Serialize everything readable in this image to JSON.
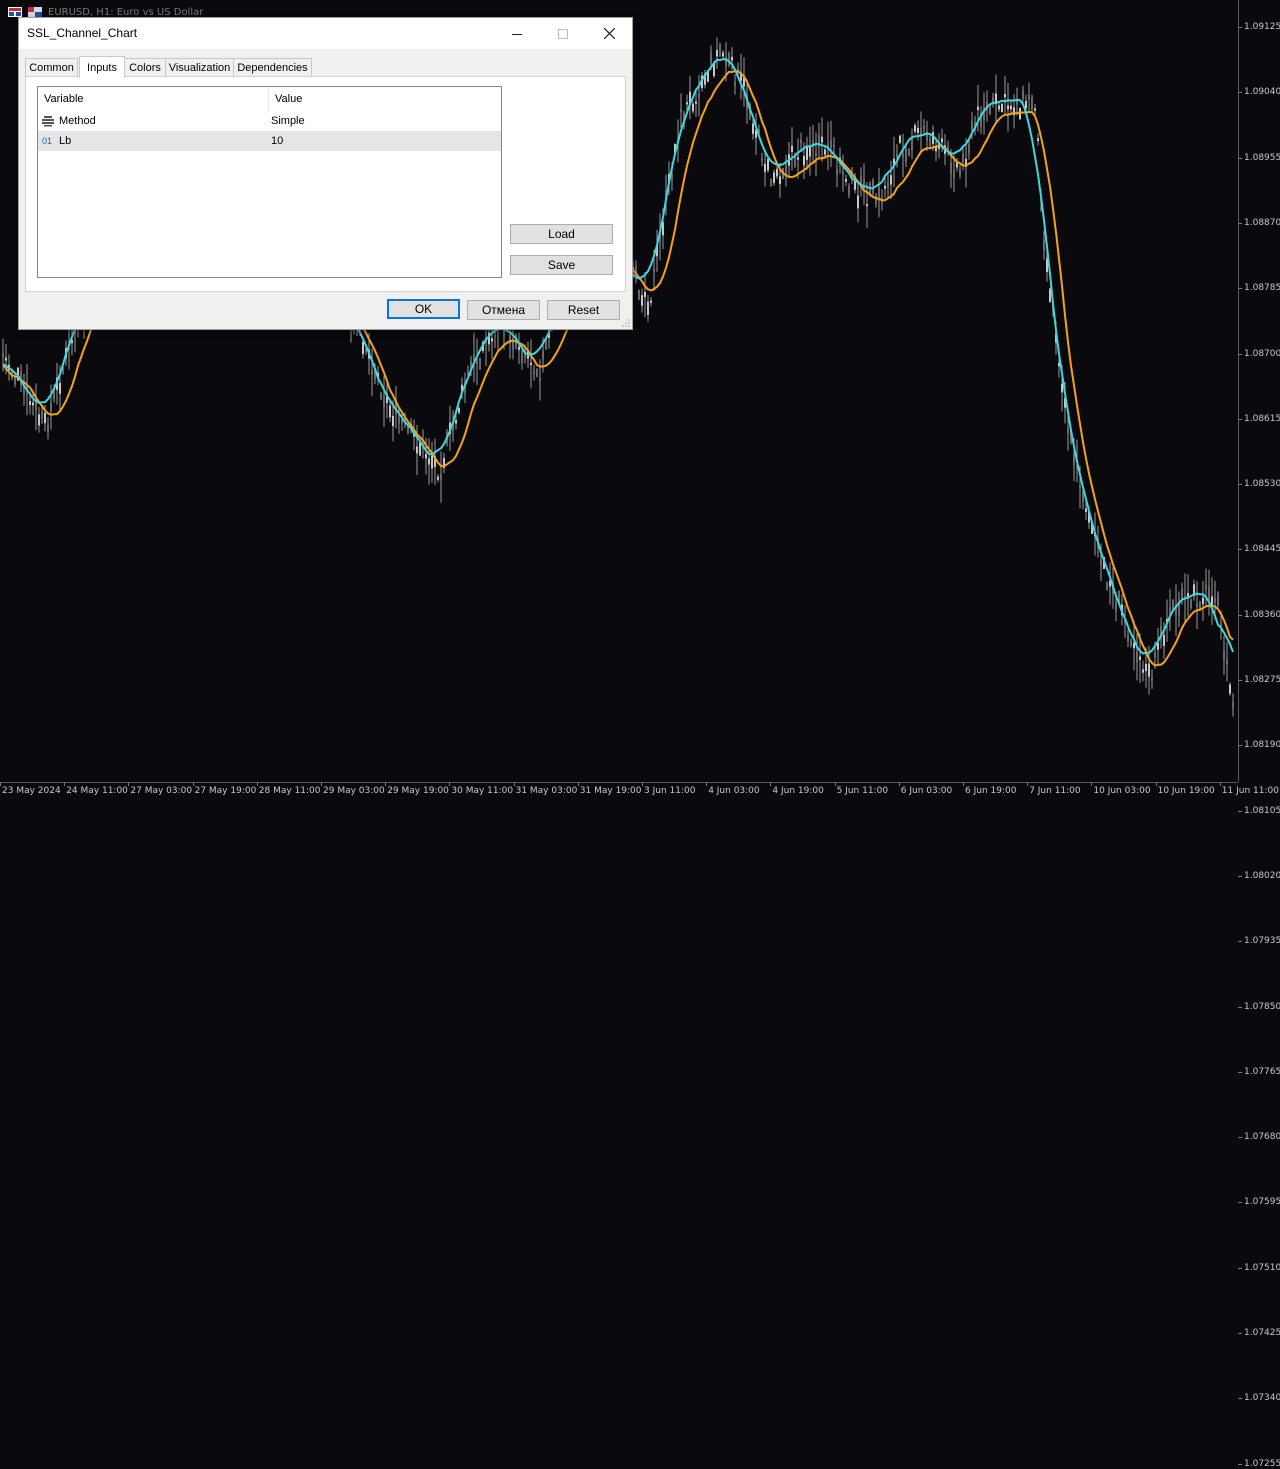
{
  "window": {
    "chart_title": "EURUSD, H1:  Euro vs US Dollar"
  },
  "colors": {
    "background": "#0a0a0e",
    "ssl_up_line": "#3fd6e0",
    "ssl_down_line": "#f5a21b",
    "candle": "#9a9a9a",
    "dialog_bg": "#f0f0f0",
    "selected_row": "#e5e5e5",
    "default_button_border": "#0078d7"
  },
  "price_axis": {
    "labels": [
      "1.09125",
      "1.09040",
      "1.08955",
      "1.08870",
      "1.08785",
      "1.08700",
      "1.08615",
      "1.08530",
      "1.08445",
      "1.08360",
      "1.08275",
      "1.08190",
      "1.08105",
      "1.08020",
      "1.07935",
      "1.07850",
      "1.07765",
      "1.07680",
      "1.07595",
      "1.07510",
      "1.07425",
      "1.07340",
      "1.07255"
    ]
  },
  "time_axis": {
    "labels": [
      "23 May 2024",
      "24 May 11:00",
      "27 May 03:00",
      "27 May 19:00",
      "28 May 11:00",
      "29 May 03:00",
      "29 May 19:00",
      "30 May 11:00",
      "31 May 03:00",
      "31 May 19:00",
      "3 Jun 11:00",
      "4 Jun 03:00",
      "4 Jun 19:00",
      "5 Jun 11:00",
      "6 Jun 03:00",
      "6 Jun 19:00",
      "7 Jun 11:00",
      "10 Jun 03:00",
      "10 Jun 19:00",
      "11 Jun 11:00"
    ]
  },
  "dialog": {
    "title": "SSL_Channel_Chart",
    "tabs": [
      {
        "label": "Common",
        "active": false
      },
      {
        "label": "Inputs",
        "active": true
      },
      {
        "label": "Colors",
        "active": false
      },
      {
        "label": "Visualization",
        "active": false
      },
      {
        "label": "Dependencies",
        "active": false
      }
    ],
    "grid": {
      "col_variable": "Variable",
      "col_value": "Value",
      "rows": [
        {
          "icon": "enum-icon",
          "variable": "Method",
          "value": "Simple"
        },
        {
          "icon": "int-icon",
          "icon_text": "01",
          "variable": "Lb",
          "value": "10"
        }
      ]
    },
    "buttons": {
      "load": "Load",
      "save": "Save",
      "ok": "OK",
      "cancel": "Отмена",
      "reset": "Reset"
    }
  }
}
